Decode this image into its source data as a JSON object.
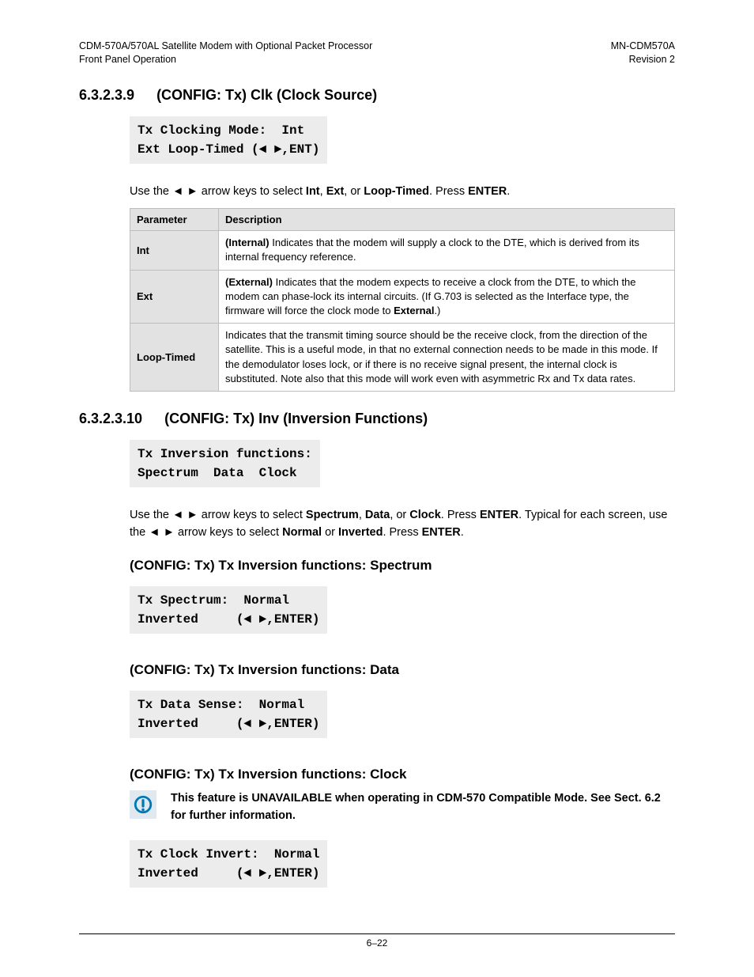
{
  "header": {
    "left": "CDM-570A/570AL Satellite Modem with Optional Packet Processor\nFront Panel Operation",
    "right": "MN-CDM570A\nRevision 2"
  },
  "sec1": {
    "num": "6.3.2.3.9",
    "title": "(CONFIG: Tx) Clk (Clock Source)",
    "lcd": "Tx Clocking Mode:  Int\nExt Loop-Timed (◄ ►,ENT)",
    "instr_pre": "Use the ◄ ► arrow keys to select ",
    "opt1": "Int",
    "sep1": ", ",
    "opt2": "Ext",
    "sep2": ", or ",
    "opt3": "Loop-Timed",
    "instr_post": ". Press ",
    "enter": "ENTER",
    "period": "."
  },
  "table": {
    "h1": "Parameter",
    "h2": "Description",
    "rows": [
      {
        "param": "Int",
        "b1": "(Internal)",
        "t1": " Indicates that the modem will supply a clock to the DTE, which is derived from its internal frequency reference."
      },
      {
        "param": "Ext",
        "b1": "(External)",
        "t1": " Indicates that the modem expects to receive a clock from the DTE, to which the modem can phase-lock its internal circuits. (If G.703 is selected as the Interface type, the firmware will force the clock mode to ",
        "b2": "External",
        "t2": ".)"
      },
      {
        "param": "Loop-Timed",
        "t1": "Indicates that the transmit timing source should be the receive clock, from the direction of the satellite. This is a useful mode, in that no external connection needs to be made in this mode. If the demodulator loses lock, or if there is no receive signal present, the internal clock is substituted. Note also that this mode will work even with asymmetric Rx and Tx data rates."
      }
    ]
  },
  "sec2": {
    "num": "6.3.2.3.10",
    "title": "(CONFIG: Tx) Inv (Inversion Functions)",
    "lcd": "Tx Inversion functions:\nSpectrum  Data  Clock",
    "instr1_pre": "Use the ◄ ► arrow keys to select ",
    "o1": "Spectrum",
    "s1": ", ",
    "o2": "Data",
    "s2": ", or ",
    "o3": "Clock",
    "instr1_mid": ". Press ",
    "enter1": "ENTER",
    "instr1_end": ". Typical for each screen, use the ◄ ► arrow keys to select ",
    "o4": "Normal",
    "s3": " or ",
    "o5": "Inverted",
    "instr1_fin": ". Press ",
    "enter2": "ENTER",
    "period": "."
  },
  "sub1": {
    "title": "(CONFIG: Tx) Tx Inversion functions: Spectrum",
    "lcd": "Tx Spectrum:  Normal\nInverted     (◄ ►,ENTER)"
  },
  "sub2": {
    "title": "(CONFIG: Tx) Tx Inversion functions: Data",
    "lcd": "Tx Data Sense:  Normal\nInverted     (◄ ►,ENTER)"
  },
  "sub3": {
    "title": "(CONFIG: Tx) Tx Inversion functions: Clock",
    "note": "This feature is UNAVAILABLE when operating in CDM-570 Compatible Mode. See Sect. 6.2 for further information.",
    "lcd": "Tx Clock Invert:  Normal\nInverted     (◄ ►,ENTER)"
  },
  "footer": "6–22"
}
